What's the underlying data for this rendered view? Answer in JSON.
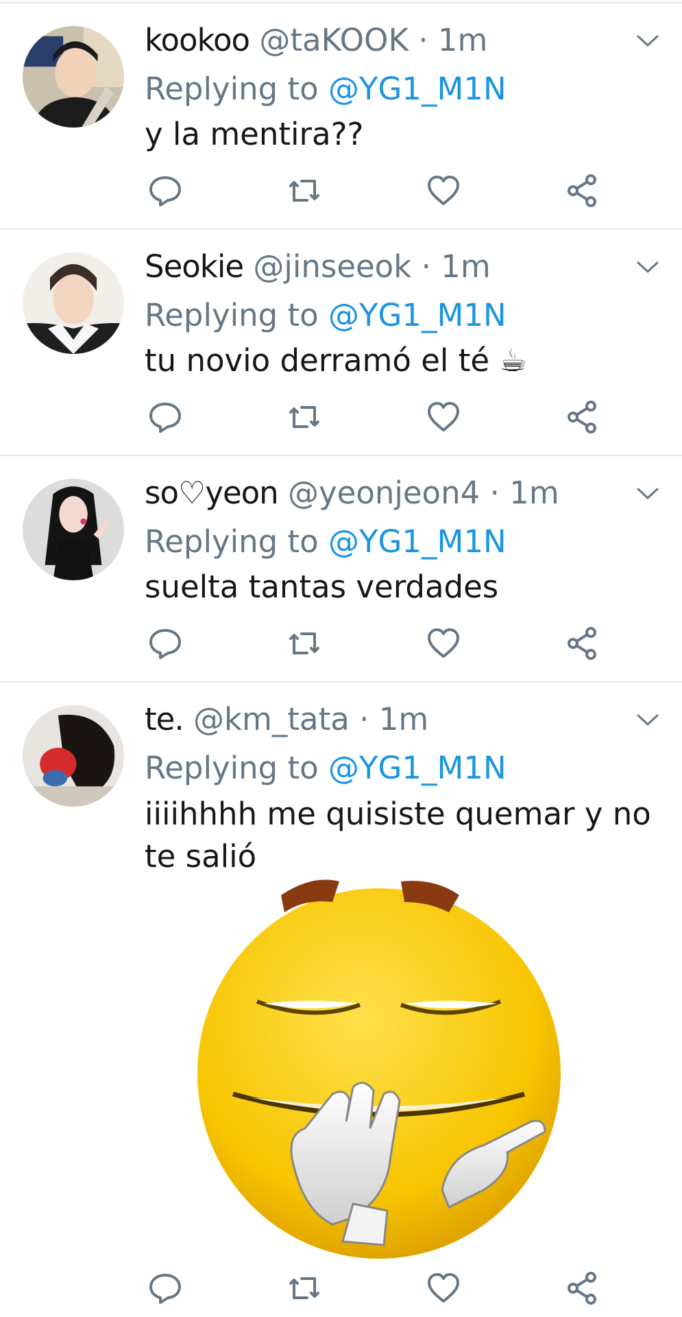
{
  "tweets": [
    {
      "display_name": "kookoo",
      "handle": "@taKOOK",
      "separator": "·",
      "time": "1m",
      "replying_prefix": "Replying to",
      "replying_to": "@YG1_M1N",
      "text": "y la mentira??"
    },
    {
      "display_name": "Seokie",
      "handle": "@jinseeok",
      "separator": "·",
      "time": "1m",
      "replying_prefix": "Replying to",
      "replying_to": "@YG1_M1N",
      "text": "tu novio derramó el té ☕"
    },
    {
      "display_name": "so♡yeon",
      "handle": "@yeonjeon4",
      "separator": "·",
      "time": "1m",
      "replying_prefix": "Replying to",
      "replying_to": "@YG1_M1N",
      "text": "suelta tantas verdades"
    },
    {
      "display_name": "te.",
      "handle": "@km_tata",
      "separator": "·",
      "time": "1m",
      "replying_prefix": "Replying to",
      "replying_to": "@YG1_M1N",
      "text": "iiiihhhh me quisiste quemar y no te salió",
      "media": "smirking-emoji-image"
    }
  ],
  "actions": [
    "reply-icon",
    "retweet-icon",
    "like-icon",
    "share-icon"
  ],
  "colors": {
    "text": "#14171a",
    "secondary": "#657786",
    "mention": "#1b95e0",
    "divider": "#e1e8ed"
  }
}
